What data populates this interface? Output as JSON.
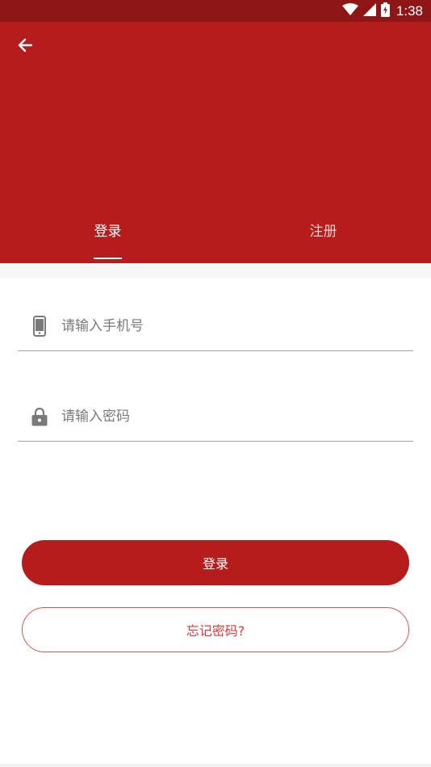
{
  "status_bar": {
    "time": "1:38",
    "icons": [
      "wifi-icon",
      "cell-signal-icon",
      "battery-charging-icon"
    ]
  },
  "header": {
    "back_icon": "arrow-left-icon",
    "tabs": [
      {
        "label": "登录",
        "active": true
      },
      {
        "label": "注册",
        "active": false
      }
    ]
  },
  "form": {
    "phone": {
      "icon": "smartphone-icon",
      "placeholder": "请输入手机号",
      "value": ""
    },
    "password": {
      "icon": "lock-icon",
      "placeholder": "请输入密码",
      "value": ""
    }
  },
  "actions": {
    "login_label": "登录",
    "forgot_label": "忘记密码?"
  },
  "colors": {
    "status_bar": "#8e1616",
    "primary": "#b51c1c",
    "outline_text": "#d63c3c",
    "outline_border": "#e05454"
  }
}
